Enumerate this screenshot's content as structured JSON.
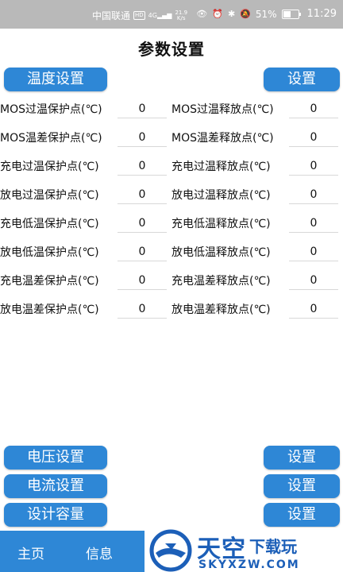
{
  "status_bar": {
    "carrier": "中国联通",
    "hd": "HD",
    "signal": "4G",
    "net_speed": "21.9",
    "net_unit": "K/s",
    "battery": "51%",
    "time": "11:29"
  },
  "page_title": "参数设置",
  "temp_section": {
    "header_label": "温度设置",
    "set_label": "设置"
  },
  "temp_rows": [
    {
      "left_label": "MOS过温保护点(℃)",
      "left_value": "0",
      "right_label": "MOS过温释放点(℃)",
      "right_value": "0"
    },
    {
      "left_label": "MOS温差保护点(℃)",
      "left_value": "0",
      "right_label": "MOS温差释放点(℃)",
      "right_value": "0"
    },
    {
      "left_label": "充电过温保护点(℃)",
      "left_value": "0",
      "right_label": "充电过温释放点(℃)",
      "right_value": "0"
    },
    {
      "left_label": "放电过温保护点(℃)",
      "left_value": "0",
      "right_label": "放电过温释放点(℃)",
      "right_value": "0"
    },
    {
      "left_label": "充电低温保护点(℃)",
      "left_value": "0",
      "right_label": "充电低温释放点(℃)",
      "right_value": "0"
    },
    {
      "left_label": "放电低温保护点(℃)",
      "left_value": "0",
      "right_label": "放电低温释放点(℃)",
      "right_value": "0"
    },
    {
      "left_label": "充电温差保护点(℃)",
      "left_value": "0",
      "right_label": "充电温差释放点(℃)",
      "right_value": "0"
    },
    {
      "left_label": "放电温差保护点(℃)",
      "left_value": "0",
      "right_label": "放电温差释放点(℃)",
      "right_value": "0"
    }
  ],
  "sections": [
    {
      "header_label": "电压设置",
      "set_label": "设置"
    },
    {
      "header_label": "电流设置",
      "set_label": "设置"
    },
    {
      "header_label": "设计容量",
      "set_label": "设置"
    }
  ],
  "bottom_nav": {
    "home": "主页",
    "info": "信息"
  },
  "watermark": {
    "name": "天空",
    "sub": "下载玩",
    "url": "SKYXZW.COM"
  },
  "colors": {
    "accent": "#2e87d6",
    "status_bar": "#b9b9b9",
    "watermark": "#1c5fb8"
  }
}
